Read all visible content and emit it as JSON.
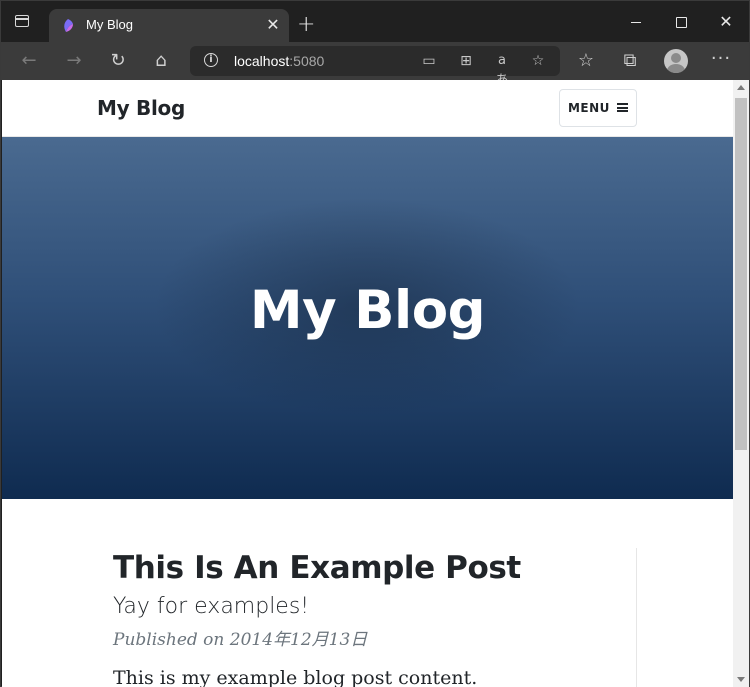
{
  "browser": {
    "tab": {
      "title": "My Blog",
      "close_glyph": "✕",
      "favicon": "blog-favicon-icon"
    },
    "new_tab_glyph": "+",
    "window_controls": {
      "close_glyph": "✕"
    },
    "toolbar": {
      "back_glyph": "←",
      "forward_glyph": "→",
      "refresh_glyph": "↻",
      "home_glyph": "⌂",
      "more_glyph": "···"
    },
    "address": {
      "host": "localhost",
      "port": ":5080",
      "info_glyph": "i",
      "device_glyph": "▭",
      "apps_glyph": "⊞",
      "read_aloud_glyph": "aあ",
      "favorite_glyph": "☆",
      "favorites_glyph": "☆",
      "collections_glyph": "⧉"
    }
  },
  "page": {
    "navbar": {
      "brand": "My Blog",
      "menu_label": "MENU"
    },
    "masthead": {
      "title": "My Blog",
      "colors": {
        "top": "#4a6a90",
        "bottom": "#0f2b50"
      }
    },
    "post": {
      "title": "This Is An Example Post",
      "subtitle": "Yay for examples!",
      "meta": "Published on 2014年12月13日",
      "excerpt": "This is my example blog post content."
    }
  }
}
